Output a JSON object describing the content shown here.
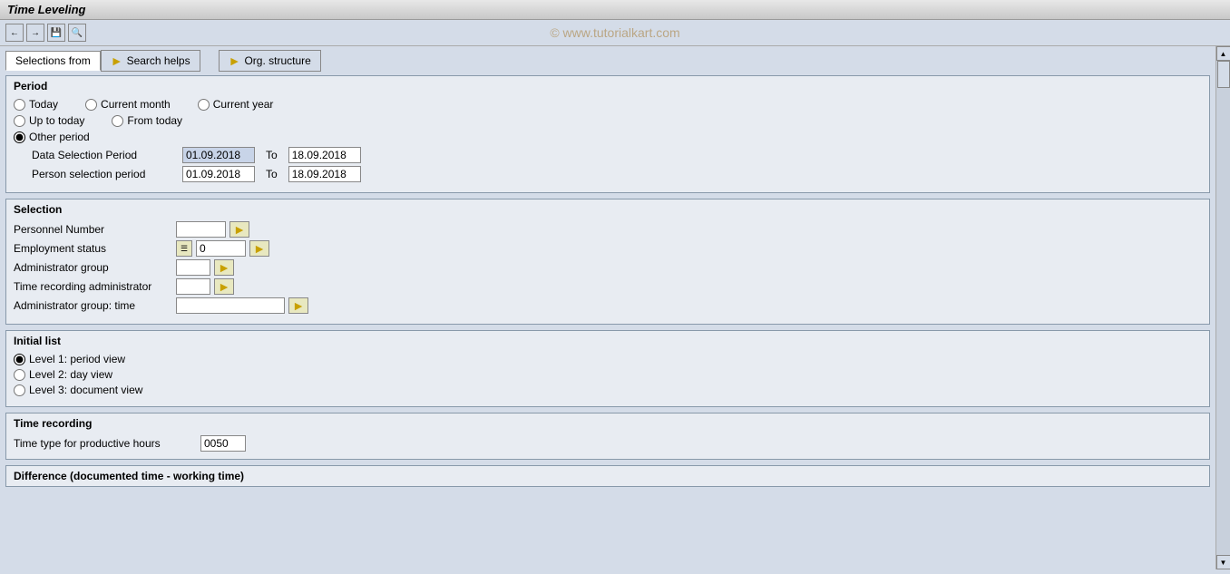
{
  "title": "Time Leveling",
  "watermark": "© www.tutorialkart.com",
  "toolbar": {
    "buttons": [
      "back",
      "forward",
      "save",
      "find"
    ]
  },
  "tabs": {
    "selections_from": "Selections from",
    "search_helps": "Search helps",
    "org_structure": "Org. structure"
  },
  "period": {
    "section_title": "Period",
    "radio_today": "Today",
    "radio_current_month": "Current month",
    "radio_current_year": "Current year",
    "radio_up_to_today": "Up to today",
    "radio_from_today": "From today",
    "radio_other_period": "Other period",
    "data_selection_period_label": "Data Selection Period",
    "data_selection_from": "01.09.2018",
    "data_selection_to": "18.09.2018",
    "person_selection_period_label": "Person selection period",
    "person_selection_from": "01.09.2018",
    "person_selection_to": "18.09.2018",
    "to_label": "To"
  },
  "selection": {
    "section_title": "Selection",
    "fields": [
      {
        "label": "Personnel Number",
        "value": "",
        "type": "text",
        "has_arrow": true
      },
      {
        "label": "Employment status",
        "value": "0",
        "type": "text",
        "has_arrow": true,
        "has_emp_icon": true
      },
      {
        "label": "Administrator group",
        "value": "",
        "type": "text",
        "has_arrow": true
      },
      {
        "label": "Time recording administrator",
        "value": "",
        "type": "text",
        "has_arrow": true
      },
      {
        "label": "Administrator group: time",
        "value": "",
        "type": "text",
        "wide": true,
        "has_arrow": true
      }
    ]
  },
  "initial_list": {
    "section_title": "Initial list",
    "options": [
      {
        "label": "Level 1: period view",
        "selected": true
      },
      {
        "label": "Level 2: day view",
        "selected": false
      },
      {
        "label": "Level 3: document view",
        "selected": false
      }
    ]
  },
  "time_recording": {
    "section_title": "Time recording",
    "time_type_label": "Time type for productive hours",
    "time_type_value": "0050"
  },
  "difference": {
    "section_title": "Difference (documented time - working time)"
  }
}
